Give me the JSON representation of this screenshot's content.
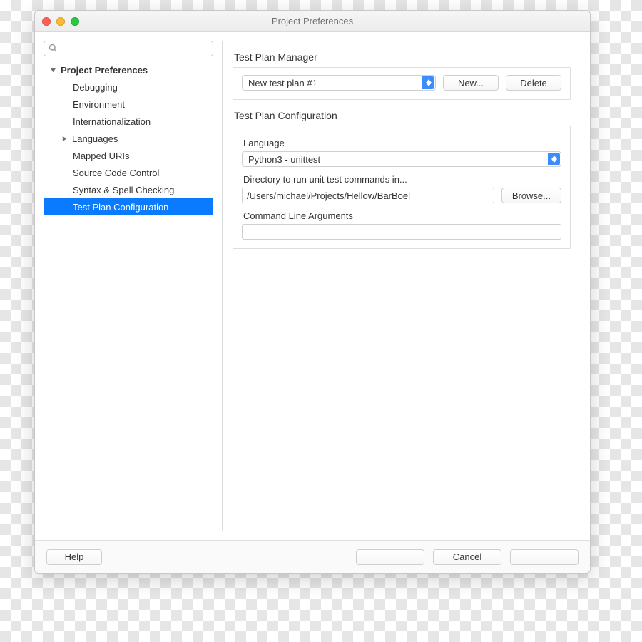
{
  "window": {
    "title": "Project Preferences"
  },
  "search": {
    "placeholder": ""
  },
  "sidebar": {
    "root": "Project Preferences",
    "items": [
      "Debugging",
      "Environment",
      "Internationalization",
      "Languages",
      "Mapped URIs",
      "Source Code Control",
      "Syntax & Spell Checking",
      "Test Plan Configuration"
    ]
  },
  "content": {
    "manager_title": "Test Plan Manager",
    "plan_selected": "New test plan #1",
    "new_button": "New...",
    "delete_button": "Delete",
    "config_title": "Test Plan Configuration",
    "language_label": "Language",
    "language_selected": "Python3 - unittest",
    "dir_label": "Directory to run unit test commands in...",
    "dir_value": "/Users/michael/Projects/Hellow/BarBoel",
    "browse_button": "Browse...",
    "args_label": "Command Line Arguments",
    "args_value": ""
  },
  "footer": {
    "help": "Help",
    "blank1": "",
    "cancel": "Cancel",
    "ok": ""
  }
}
